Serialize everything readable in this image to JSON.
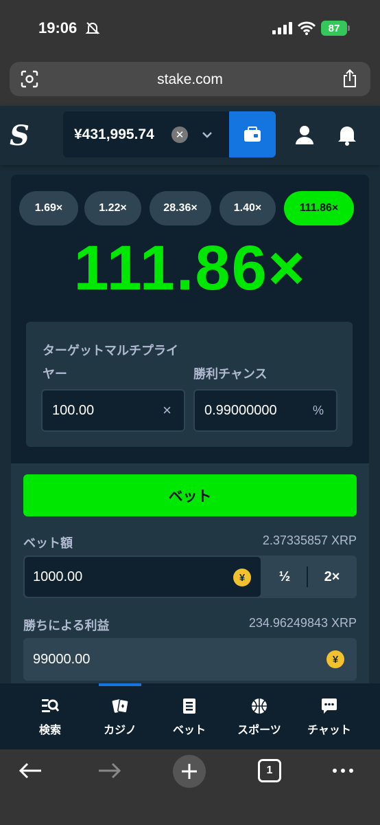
{
  "status_bar": {
    "time": "19:06",
    "battery": "87"
  },
  "browser": {
    "url": "stake.com",
    "tab_count": "1"
  },
  "header": {
    "logo": "S",
    "balance": "¥431,995.74",
    "currency_icon": "xrp-icon",
    "accent_color": "#1475e1"
  },
  "game": {
    "history": [
      "1.69×",
      "1.22×",
      "28.36×",
      "1.40×",
      "111.86×"
    ],
    "result_multiplier": "111.86×",
    "result_color": "#00e701",
    "target_multiplier_label": "ターゲットマルチプライヤー",
    "target_multiplier_label_line1": "ターゲットマルチプライ",
    "target_multiplier_label_line2": "ヤー",
    "target_multiplier_value": "100.00",
    "target_multiplier_suffix": "×",
    "win_chance_label": "勝利チャンス",
    "win_chance_value": "0.99000000",
    "win_chance_suffix": "%"
  },
  "controls": {
    "bet_button": "ベット",
    "bet_amount_label": "ベット額",
    "bet_amount_crypto": "2.37335857 XRP",
    "bet_amount_value": "1000.00",
    "currency_symbol": "¥",
    "half_label": "½",
    "double_label": "2×",
    "profit_label": "勝ちによる利益",
    "profit_crypto": "234.96249843 XRP",
    "profit_value": "99000.00"
  },
  "bottom_nav": {
    "items": [
      {
        "label": "検索",
        "icon": "search-icon"
      },
      {
        "label": "カジノ",
        "icon": "cards-icon"
      },
      {
        "label": "ベット",
        "icon": "betslip-icon"
      },
      {
        "label": "スポーツ",
        "icon": "basketball-icon"
      },
      {
        "label": "チャット",
        "icon": "chat-icon"
      }
    ],
    "active_index": 1
  }
}
